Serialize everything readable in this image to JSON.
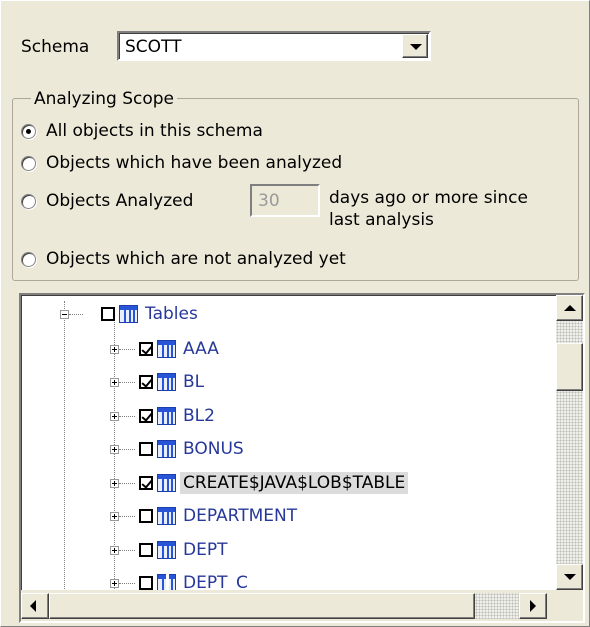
{
  "schema": {
    "label": "Schema",
    "value": "SCOTT"
  },
  "scope": {
    "title": "Analyzing Scope",
    "options": [
      {
        "label": "All objects in this schema",
        "checked": true
      },
      {
        "label": "Objects which have been analyzed",
        "checked": false
      },
      {
        "label": "Objects Analyzed",
        "checked": false
      },
      {
        "label": "Objects which are not analyzed yet",
        "checked": false
      }
    ],
    "days_value": "30",
    "days_text_line1": "days ago or more since",
    "days_text_line2": "last analysis"
  },
  "tree": {
    "root": {
      "label": "Tables",
      "checked": false,
      "expanded": true
    },
    "items": [
      {
        "label": "AAA",
        "checked": true,
        "icon": "table-icon"
      },
      {
        "label": "BL",
        "checked": true,
        "icon": "table-icon"
      },
      {
        "label": "BL2",
        "checked": true,
        "icon": "table-icon"
      },
      {
        "label": "BONUS",
        "checked": false,
        "icon": "table-icon"
      },
      {
        "label": "CREATE$JAVA$LOB$TABLE",
        "checked": true,
        "icon": "table-icon",
        "selected": true
      },
      {
        "label": "DEPARTMENT",
        "checked": false,
        "icon": "table-icon"
      },
      {
        "label": "DEPT",
        "checked": false,
        "icon": "table-icon"
      },
      {
        "label": "DEPT_C",
        "checked": false,
        "icon": "partitioned-table-icon"
      }
    ]
  }
}
